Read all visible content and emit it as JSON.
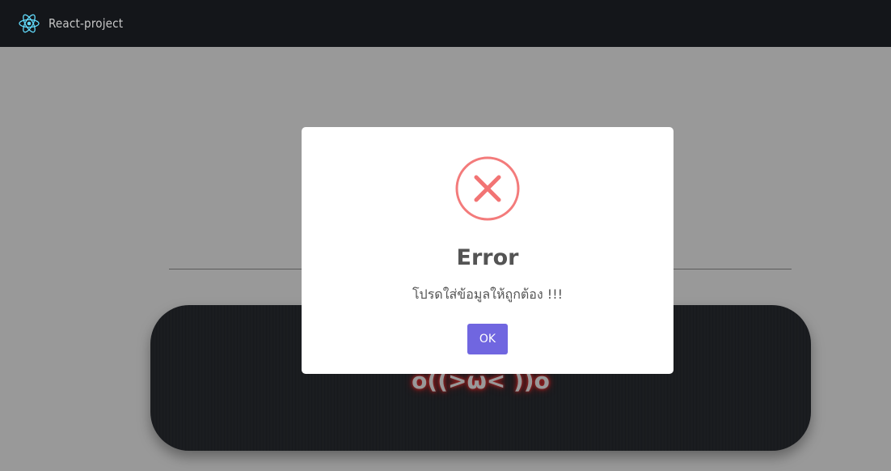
{
  "navbar": {
    "brand_label": "React-project",
    "logo_icon": "react-logo-icon",
    "logo_color": "#61dafb",
    "background": "#14161a"
  },
  "page": {
    "banner_text": "o((>ω< ))o"
  },
  "modal": {
    "icon": "error-x-icon",
    "icon_color": "#f27474",
    "title": "Error",
    "message": "โปรดใส่ข้อมูลให้ถูกต้อง !!!",
    "ok_label": "OK",
    "ok_color": "#7066e0"
  }
}
